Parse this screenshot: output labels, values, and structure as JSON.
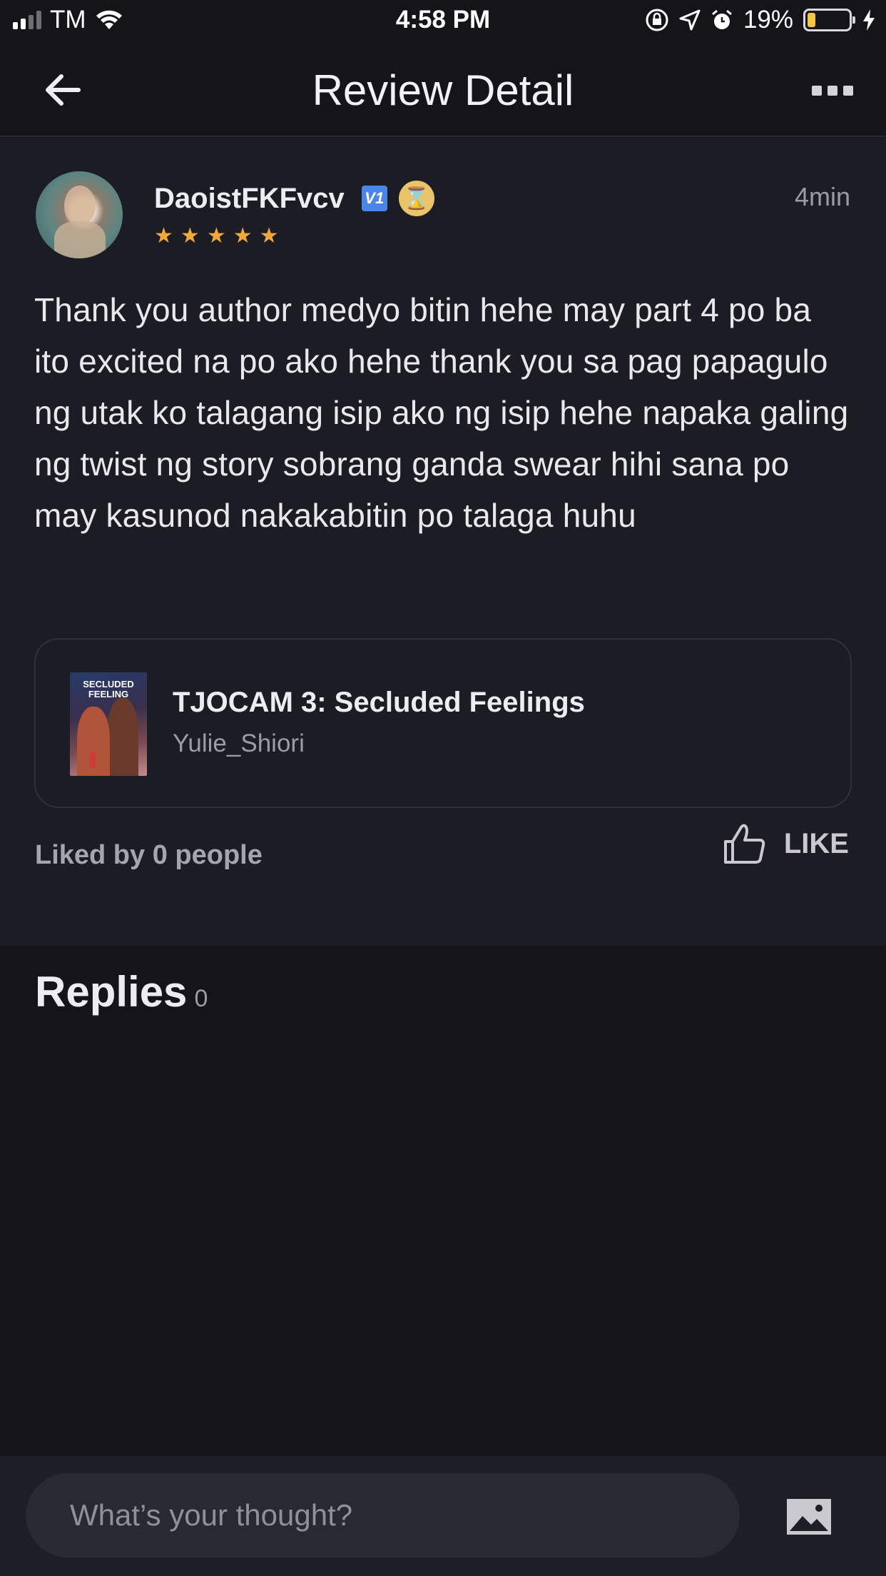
{
  "status_bar": {
    "carrier": "TM",
    "time": "4:58 PM",
    "battery": "19%",
    "battery_level": 0.19
  },
  "header": {
    "title": "Review Detail"
  },
  "review": {
    "username": "DaoistFKFvcv",
    "level_badge": "V1",
    "rating": 5,
    "stars": "★ ★ ★ ★ ★",
    "time_ago": "4min",
    "text": "Thank you author medyo bitin hehe may part 4 po ba ito excited na po ako hehe thank you sa pag papagulo ng utak ko talagang isip ako ng isip hehe napaka galing ng twist ng story sobrang ganda swear hihi sana po may kasunod nakakabitin po talaga huhu",
    "book": {
      "title": "TJOCAM 3: Secluded Feelings",
      "author": "Yulie_Shiori",
      "cover_text": "SECLUDED FEELING"
    },
    "liked_by": "Liked by 0 people",
    "like_label": "LIKE"
  },
  "replies": {
    "title": "Replies",
    "count": "0"
  },
  "composer": {
    "placeholder": "What’s your thought?"
  },
  "colors": {
    "background": "#141419",
    "card": "#1c1d24",
    "star": "#f2a73b",
    "text_primary": "#ecedf0",
    "text_secondary": "#9b9ca3"
  }
}
